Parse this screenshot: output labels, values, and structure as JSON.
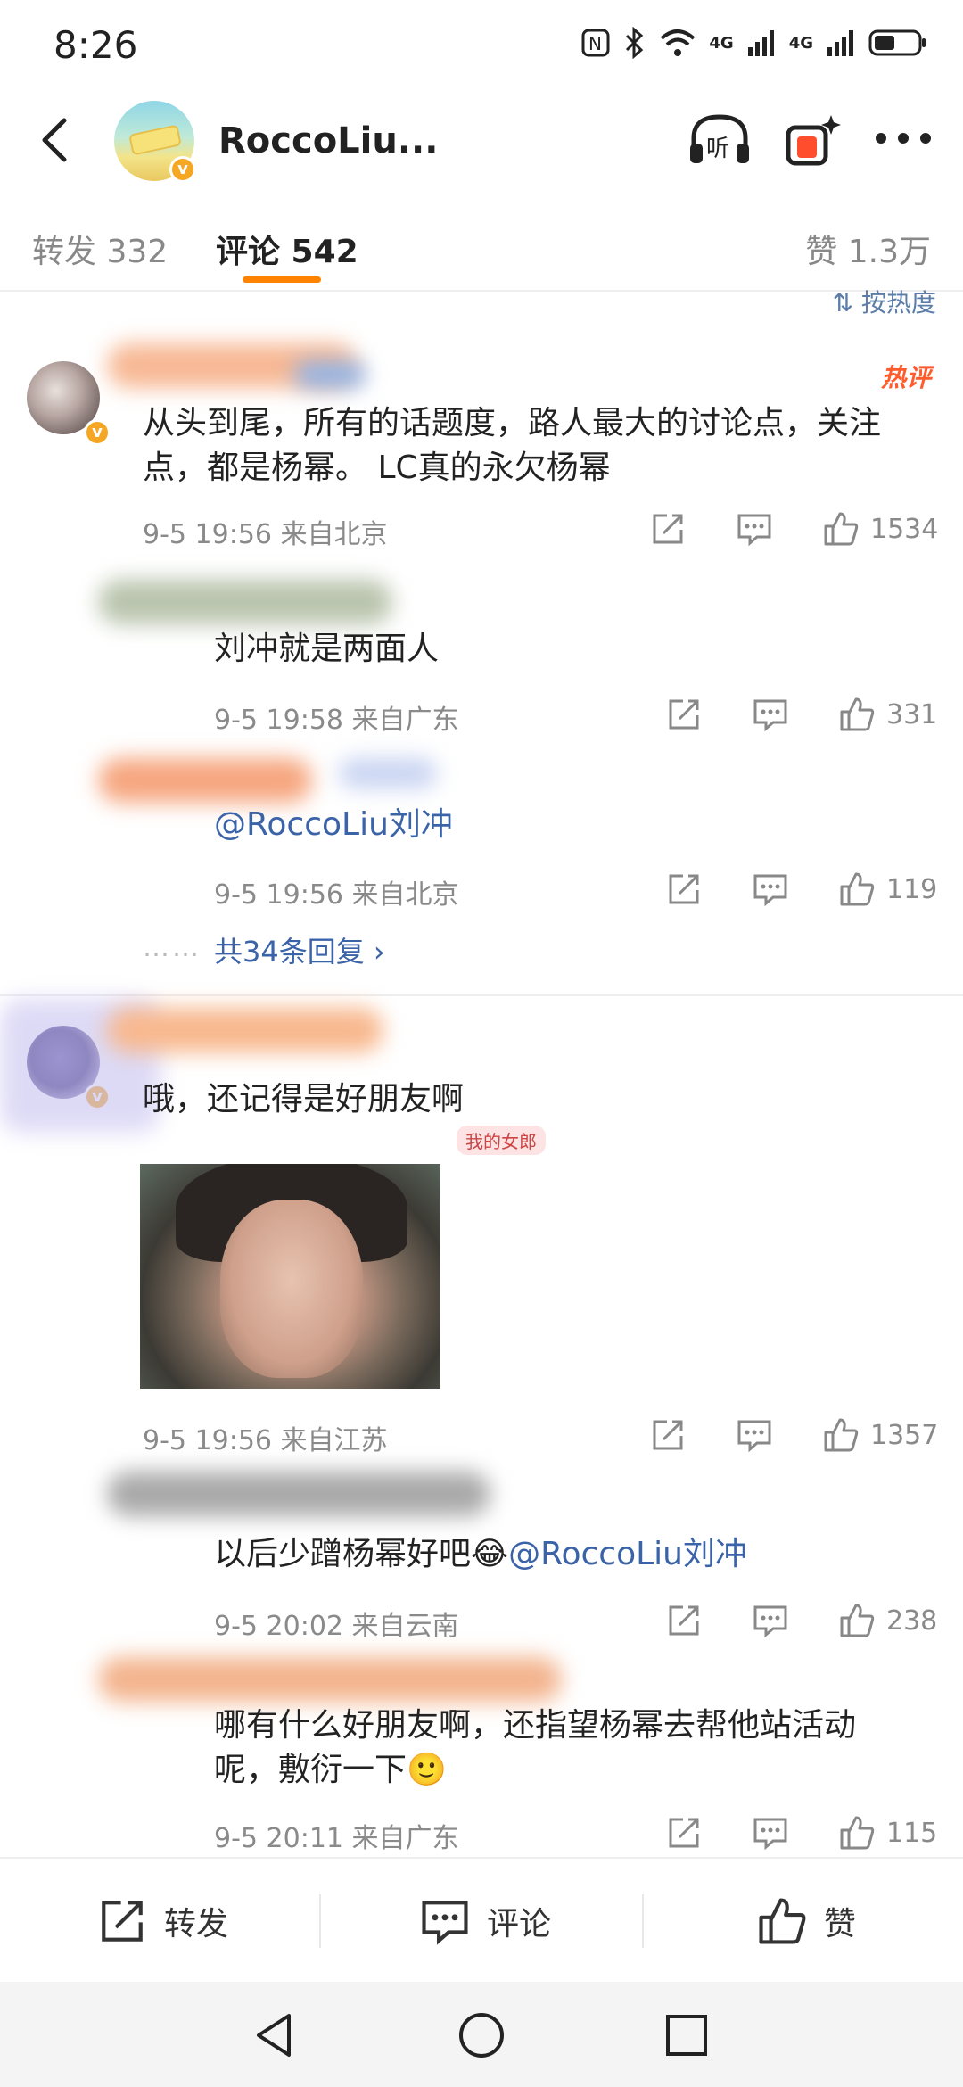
{
  "status": {
    "time": "8:26",
    "network_1": "4G",
    "network_2": "4G"
  },
  "header": {
    "title": "RoccoLiu..."
  },
  "tabs": [
    {
      "label": "转发 332"
    },
    {
      "label": "评论 542"
    },
    {
      "label": "赞 1.3万"
    }
  ],
  "sort_label": "⇅ 按热度",
  "comments": [
    {
      "hot_tag": "热评",
      "text": "从头到尾，所有的话题度，路人最大的讨论点，关注点，都是杨幂。 LC真的永欠杨幂",
      "meta": "9-5 19:56  来自北京",
      "likes": "1534",
      "replies": [
        {
          "text": "刘冲就是两面人",
          "meta": "9-5 19:58  来自广东",
          "likes": "331"
        },
        {
          "text": "@RoccoLiu刘冲",
          "meta": "9-5 19:56  来自北京",
          "likes": "119"
        }
      ],
      "more_replies": "共34条回复 ›",
      "dots": "……"
    },
    {
      "text": "哦，还记得是好朋友啊",
      "tag": "我的女郎",
      "meta": "9-5 19:56  来自江苏",
      "likes": "1357",
      "replies": [
        {
          "text": "以后少蹭杨幂好吧",
          "mention": "@RoccoLiu刘冲",
          "meta": "9-5 20:02  来自云南",
          "likes": "238"
        },
        {
          "text": "哪有什么好朋友啊，还指望杨幂去帮他站活动呢，敷衍一下",
          "meta": "9-5 20:11  来自广东",
          "likes": "115"
        }
      ]
    }
  ],
  "bottom_bar": {
    "repost": "转发",
    "comment": "评论",
    "like": "赞"
  },
  "icons": {
    "back": "back-arrow-icon",
    "listen": "listen-icon",
    "gift": "gift-icon",
    "more": "more-icon",
    "share": "share-icon",
    "comment": "comment-icon",
    "like": "thumbs-up-icon"
  },
  "colors": {
    "accent": "#ff8200",
    "link": "#3a63a8",
    "hot": "#ff5b2c"
  }
}
